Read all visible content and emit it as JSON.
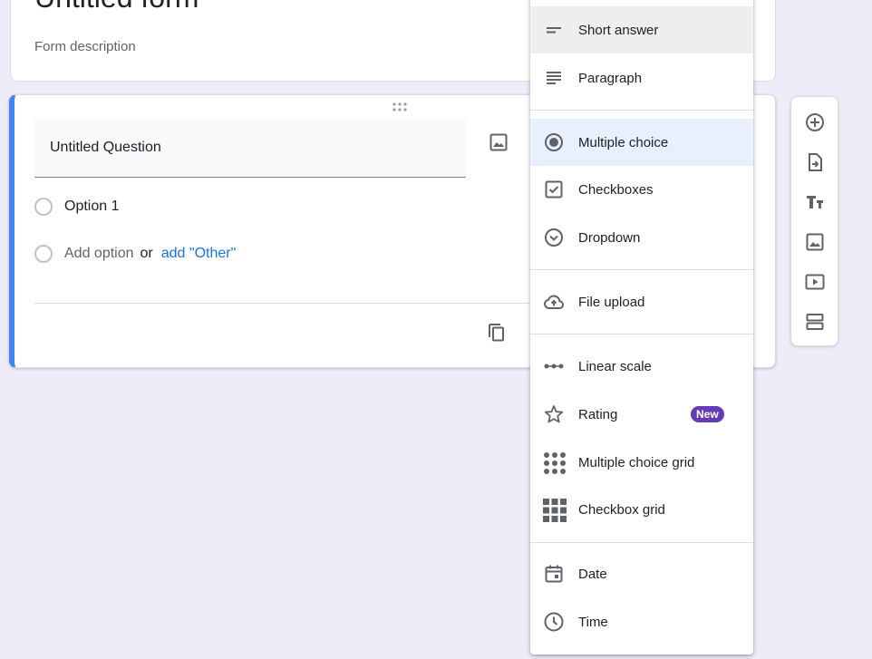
{
  "form": {
    "title": "Untitled form",
    "description": "Form description"
  },
  "question": {
    "title": "Untitled Question",
    "options": [
      "Option 1"
    ],
    "add_option": "Add option",
    "or": "or",
    "add_other": "add \"Other\""
  },
  "type_menu": {
    "items": [
      {
        "label": "Short answer",
        "icon": "short-answer-icon"
      },
      {
        "label": "Paragraph",
        "icon": "paragraph-icon"
      },
      {
        "label": "Multiple choice",
        "icon": "radio-button-icon"
      },
      {
        "label": "Checkboxes",
        "icon": "checkbox-icon"
      },
      {
        "label": "Dropdown",
        "icon": "dropdown-icon"
      },
      {
        "label": "File upload",
        "icon": "cloud-upload-icon"
      },
      {
        "label": "Linear scale",
        "icon": "linear-scale-icon"
      },
      {
        "label": "Rating",
        "icon": "star-icon",
        "badge": "New"
      },
      {
        "label": "Multiple choice grid",
        "icon": "dot-grid-icon"
      },
      {
        "label": "Checkbox grid",
        "icon": "square-grid-icon"
      },
      {
        "label": "Date",
        "icon": "calendar-icon"
      },
      {
        "label": "Time",
        "icon": "clock-icon"
      }
    ],
    "selected": "Multiple choice"
  },
  "toolbar": {
    "icons": [
      "add-question-icon",
      "import-questions-icon",
      "add-title-icon",
      "add-image-icon",
      "add-video-icon",
      "add-section-icon"
    ]
  },
  "colors": {
    "background": "#f0ebf8",
    "accent": "#4285f4",
    "link": "#1a73e8",
    "badge": "#673ab7",
    "selected_bg": "#e8f0fe"
  }
}
